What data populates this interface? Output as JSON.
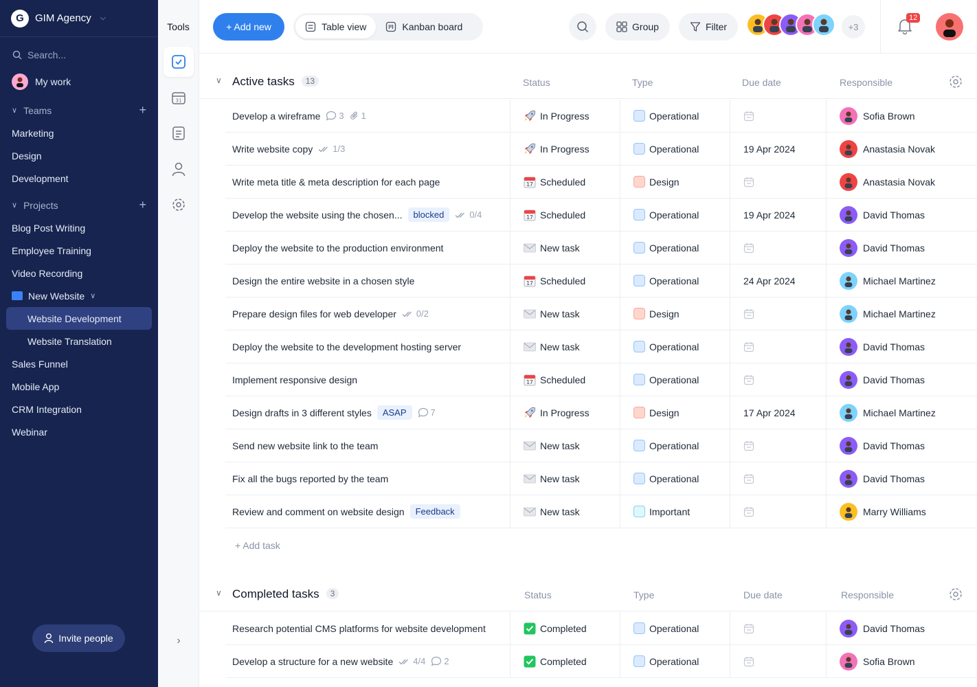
{
  "workspace": {
    "logo": "G",
    "name": "GIM Agency"
  },
  "sidebar": {
    "search_placeholder": "Search...",
    "my_work": "My work",
    "teams_label": "Teams",
    "teams": [
      "Marketing",
      "Design",
      "Development"
    ],
    "projects_label": "Projects",
    "projects_top": [
      "Blog Post Writing",
      "Employee Training",
      "Video Recording"
    ],
    "folder": "New Website",
    "folder_items": [
      "Website Development",
      "Website Translation"
    ],
    "projects_bottom": [
      "Sales Funnel",
      "Mobile App",
      "CRM Integration",
      "Webinar"
    ],
    "invite": "Invite people"
  },
  "tools": {
    "title": "Tools"
  },
  "toolbar": {
    "add_new": "+ Add new",
    "table_view": "Table view",
    "kanban_board": "Kanban board",
    "group": "Group",
    "filter": "Filter",
    "more_members": "+3",
    "notifications": "12"
  },
  "columns": {
    "status": "Status",
    "type": "Type",
    "due": "Due date",
    "responsible": "Responsible"
  },
  "active": {
    "title": "Active tasks",
    "count": "13",
    "add_task": "+ Add task",
    "rows": [
      {
        "name": "Develop a wireframe",
        "tag": "",
        "meta": [
          {
            "icon": "comment-icon",
            "text": "3"
          },
          {
            "icon": "attachment-icon",
            "text": "1"
          }
        ],
        "status": "In Progress",
        "status_icon": "rocket",
        "type": "Operational",
        "due": "",
        "responsible": "Sofia Brown",
        "avatar": "#f472b6"
      },
      {
        "name": "Write website copy",
        "tag": "",
        "meta": [
          {
            "icon": "checklist-icon",
            "text": "1/3"
          }
        ],
        "status": "In Progress",
        "status_icon": "rocket",
        "type": "Operational",
        "due": "19 Apr 2024",
        "responsible": "Anastasia Novak",
        "avatar": "#ef4444"
      },
      {
        "name": "Write meta title & meta description for each page",
        "tag": "",
        "meta": [],
        "status": "Scheduled",
        "status_icon": "calendar",
        "type": "Design",
        "due": "",
        "responsible": "Anastasia Novak",
        "avatar": "#ef4444"
      },
      {
        "name": "Develop the website using the chosen...",
        "tag": "blocked",
        "meta": [
          {
            "icon": "checklist-icon",
            "text": "0/4"
          }
        ],
        "status": "Scheduled",
        "status_icon": "calendar",
        "type": "Operational",
        "due": "19 Apr 2024",
        "responsible": "David Thomas",
        "avatar": "#8b5cf6"
      },
      {
        "name": "Deploy the website to the production environment",
        "tag": "",
        "meta": [],
        "status": "New task",
        "status_icon": "envelope",
        "type": "Operational",
        "due": "",
        "responsible": "David Thomas",
        "avatar": "#8b5cf6"
      },
      {
        "name": "Design the entire website in a chosen style",
        "tag": "",
        "meta": [],
        "status": "Scheduled",
        "status_icon": "calendar",
        "type": "Operational",
        "due": "24 Apr 2024",
        "responsible": "Michael Martinez",
        "avatar": "#7dd3fc"
      },
      {
        "name": "Prepare design files for web developer",
        "tag": "",
        "meta": [
          {
            "icon": "checklist-icon",
            "text": "0/2"
          }
        ],
        "status": "New task",
        "status_icon": "envelope",
        "type": "Design",
        "due": "",
        "responsible": "Michael Martinez",
        "avatar": "#7dd3fc"
      },
      {
        "name": "Deploy the website to the development hosting server",
        "tag": "",
        "meta": [],
        "status": "New task",
        "status_icon": "envelope",
        "type": "Operational",
        "due": "",
        "responsible": "David Thomas",
        "avatar": "#8b5cf6"
      },
      {
        "name": "Implement responsive design",
        "tag": "",
        "meta": [],
        "status": "Scheduled",
        "status_icon": "calendar",
        "type": "Operational",
        "due": "",
        "responsible": "David Thomas",
        "avatar": "#8b5cf6"
      },
      {
        "name": "Design drafts in 3 different styles",
        "tag": "ASAP",
        "meta": [
          {
            "icon": "comment-icon",
            "text": "7"
          }
        ],
        "status": "In Progress",
        "status_icon": "rocket",
        "type": "Design",
        "due": "17 Apr 2024",
        "responsible": "Michael Martinez",
        "avatar": "#7dd3fc"
      },
      {
        "name": "Send new website link to the team",
        "tag": "",
        "meta": [],
        "status": "New task",
        "status_icon": "envelope",
        "type": "Operational",
        "due": "",
        "responsible": "David Thomas",
        "avatar": "#8b5cf6"
      },
      {
        "name": "Fix all the bugs reported by the team",
        "tag": "",
        "meta": [],
        "status": "New task",
        "status_icon": "envelope",
        "type": "Operational",
        "due": "",
        "responsible": "David Thomas",
        "avatar": "#8b5cf6"
      },
      {
        "name": "Review and comment on website design",
        "tag": "Feedback",
        "meta": [],
        "status": "New task",
        "status_icon": "envelope",
        "type": "Important",
        "due": "",
        "responsible": "Marry Williams",
        "avatar": "#fbbf24"
      }
    ]
  },
  "completed": {
    "title": "Completed tasks",
    "count": "3",
    "rows": [
      {
        "name": "Research potential CMS platforms for website development",
        "tag": "",
        "meta": [],
        "status": "Completed",
        "status_icon": "check",
        "type": "Operational",
        "due": "",
        "responsible": "David Thomas",
        "avatar": "#8b5cf6"
      },
      {
        "name": "Develop a structure for a new website",
        "tag": "",
        "meta": [
          {
            "icon": "checklist-icon",
            "text": "4/4"
          },
          {
            "icon": "comment-icon",
            "text": "2"
          }
        ],
        "status": "Completed",
        "status_icon": "check",
        "type": "Operational",
        "due": "",
        "responsible": "Sofia Brown",
        "avatar": "#f472b6"
      }
    ]
  },
  "type_colors": {
    "Operational": {
      "bg": "#dbeafe",
      "border": "#93c5fd"
    },
    "Design": {
      "bg": "#fed7cc",
      "border": "#fca5a5"
    },
    "Important": {
      "bg": "#e0f7fa",
      "border": "#7dd3fc"
    }
  },
  "member_colors": [
    "#fbbf24",
    "#ef4444",
    "#8b5cf6",
    "#f472b6",
    "#7dd3fc"
  ]
}
